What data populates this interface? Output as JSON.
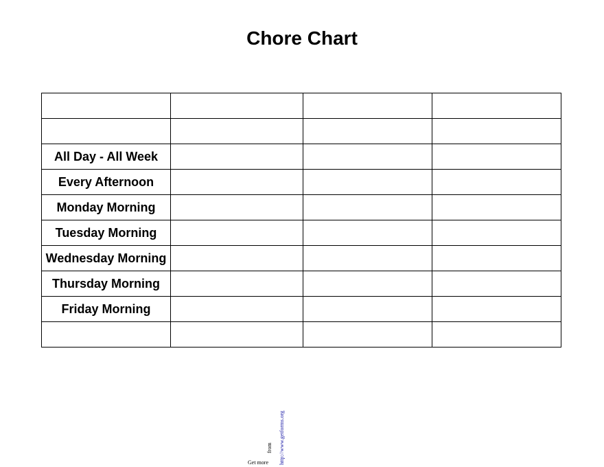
{
  "title": "Chore Chart",
  "rows": [
    {
      "label": ""
    },
    {
      "label": ""
    },
    {
      "label": "All Day - All Week"
    },
    {
      "label": "Every Afternoon"
    },
    {
      "label": "Monday Morning"
    },
    {
      "label": "Tuesday Morning"
    },
    {
      "label": "Wednesday Morning"
    },
    {
      "label": "Thursday Morning"
    },
    {
      "label": "Friday Morning"
    },
    {
      "label": ""
    }
  ],
  "footer": {
    "get_more": "Get more",
    "from": "from",
    "url": "http://www.getforms.org"
  }
}
